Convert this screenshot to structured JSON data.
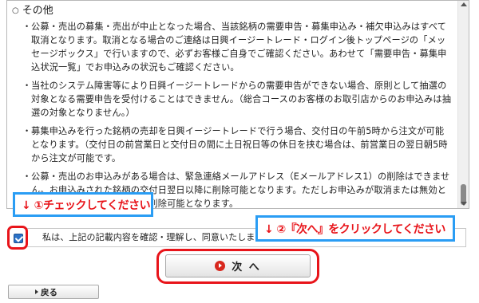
{
  "section": {
    "title": "その他",
    "items": [
      "公募・売出の募集・売出が中止となった場合、当該銘柄の需要申告・募集申込み・補欠申込みはすべて取消となります。取消となる場合のご連絡は日興イージートレード・ログイン後トップページの「メッセージボックス」で行いますので、必ずお客様ご自身でご確認ください。あわせて「需要申告・募集申込状況一覧」でお申込みの状況もご確認ください。",
      "当社のシステム障害等により日興イージートレードからの需要申告ができない場合、原則として抽選の対象となる需要申告を受付けることはできません。（総合コースのお客様のお取引店からのお申込みは抽選の対象となりません。）",
      "募集申込みを行った銘柄の売却を日興イージートレードで行う場合、交付日の午前5時から注文が可能となります。（交付日の前営業日と交付日の間に土日祝日等の休日を挟む場合は、前営業日の翌日朝5時から注文が可能です。",
      "公募・売出のお申込みがある場合は、緊急連絡メールアドレス（Eメールアドレス1）の削除はできません。お申込みされた銘柄の交付日翌日以降に削除可能となります。ただしお申込みが取消または無効となった場合は、その当日から削除可能となります。"
    ]
  },
  "callouts": {
    "step1": "↓ ①チェックしてください",
    "step2": "↓ ②『次へ』をクリックしてください"
  },
  "agreement": {
    "label": "私は、上記の記載内容を確認・理解し、同意いたします。",
    "checked": true
  },
  "buttons": {
    "next": "次 へ",
    "back": "戻る"
  },
  "colors": {
    "highlight_red": "#e8141a",
    "callout_blue": "#2a9df4",
    "checkbox_blue": "#2b72c7"
  }
}
